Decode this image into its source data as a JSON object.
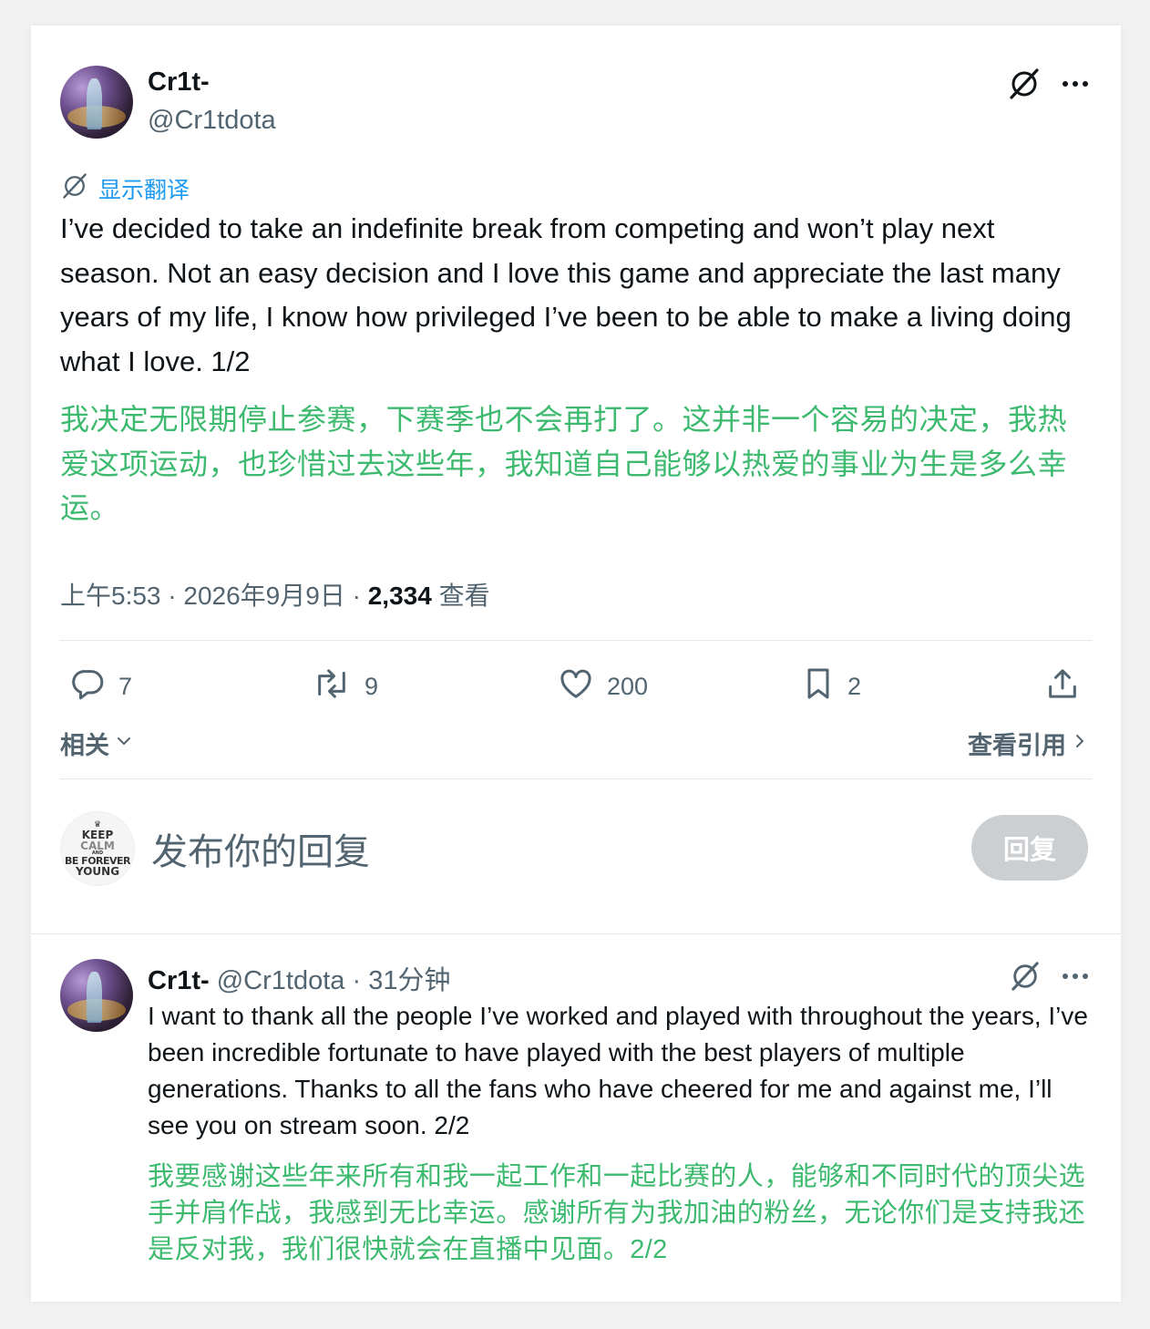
{
  "post": {
    "author_name": "Cr1t-",
    "author_handle": "@Cr1tdota",
    "show_translation": "显示翻译",
    "text_en": "I’ve decided to take an indefinite break from competing and won’t play next season. Not an easy decision and I love this game and appreciate the last many years of my life, I know how privileged I’ve been to be able to make a living doing what I love. 1/2",
    "text_zh": "我决定无限期停止参赛，下赛季也不会再打了。这并非一个容易的决定，我热爱这项运动，也珍惜过去这些年，我知道自己能够以热爱的事业为生是多么幸运。",
    "time": "上午5:53",
    "date": "2026年9月9日",
    "separator": "·",
    "views_count": "2,334",
    "views_label": "查看"
  },
  "actions": {
    "replies": "7",
    "reposts": "9",
    "likes": "200",
    "bookmarks": "2"
  },
  "related": {
    "label": "相关",
    "quotes_label": "查看引用"
  },
  "compose": {
    "placeholder": "发布你的回复",
    "reply_button": "回复",
    "avatar_text": {
      "line1": "KEEP",
      "line2": "CALM",
      "line3": "AND",
      "line4": "BE FOREVER",
      "line5": "YOUNG"
    }
  },
  "reply": {
    "author_name": "Cr1t-",
    "author_handle": "@Cr1tdota",
    "time_ago": "31分钟",
    "separator": "·",
    "text_en": "I want to thank all the people I’ve worked and played with throughout the years, I’ve been incredible fortunate to have played with the best players of multiple generations. Thanks to all the fans who have cheered for me and against me, I’ll see you on stream soon. 2/2",
    "text_zh": "我要感谢这些年来所有和我一起工作和一起比赛的人，能够和不同时代的顶尖选手并肩作战，我感到无比幸运。感谢所有为我加油的粉丝，无论你们是支持我还是反对我，我们很快就会在直播中见面。2/2"
  },
  "colors": {
    "translation_text": "#3dba6f",
    "link_blue": "#1d9bf0",
    "secondary_text": "#536471",
    "reply_button_disabled": "#cccfd2"
  },
  "icons": [
    "grok-slash-icon",
    "more-icon",
    "translate-icon",
    "reply-icon",
    "repost-icon",
    "like-icon",
    "bookmark-icon",
    "share-icon",
    "chevron-down-icon",
    "chevron-right-icon"
  ]
}
